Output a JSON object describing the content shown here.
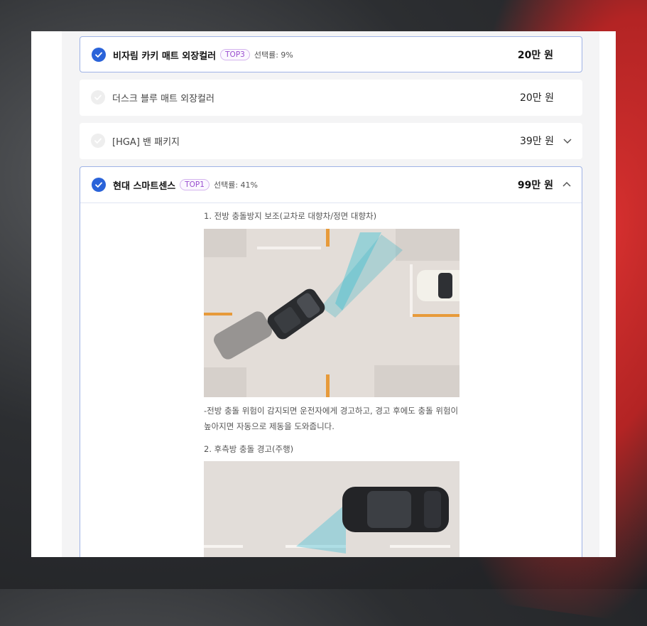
{
  "options": [
    {
      "name": "비자림 카키 매트 외장컬러",
      "badge": "TOP3",
      "rate": "선택률: 9%",
      "price": "20만 원",
      "selected": true
    },
    {
      "name": "더스크 블루 매트 외장컬러",
      "price": "20만 원",
      "selected": false
    },
    {
      "name": "[HGA] 밴 패키지",
      "price": "39만 원",
      "selected": false
    },
    {
      "name": "현대 스마트센스",
      "badge": "TOP1",
      "rate": "선택률: 41%",
      "price": "99만 원",
      "selected": true
    }
  ],
  "detail": {
    "feature1_title": "1. 전방 충돌방지 보조(교차로 대향차/정면 대향차)",
    "feature1_desc": "-전방 충돌 위험이 감지되면 운전자에게 경고하고, 경고 후에도 충돌 위험이 높아지면 자동으로 제동을 도와줍니다.",
    "feature2_title": "2. 후측방 충돌 경고(주행)"
  },
  "colors": {
    "accent": "#2a63d9",
    "badge": "#9a4fd0",
    "border": "#9fb3e6"
  }
}
